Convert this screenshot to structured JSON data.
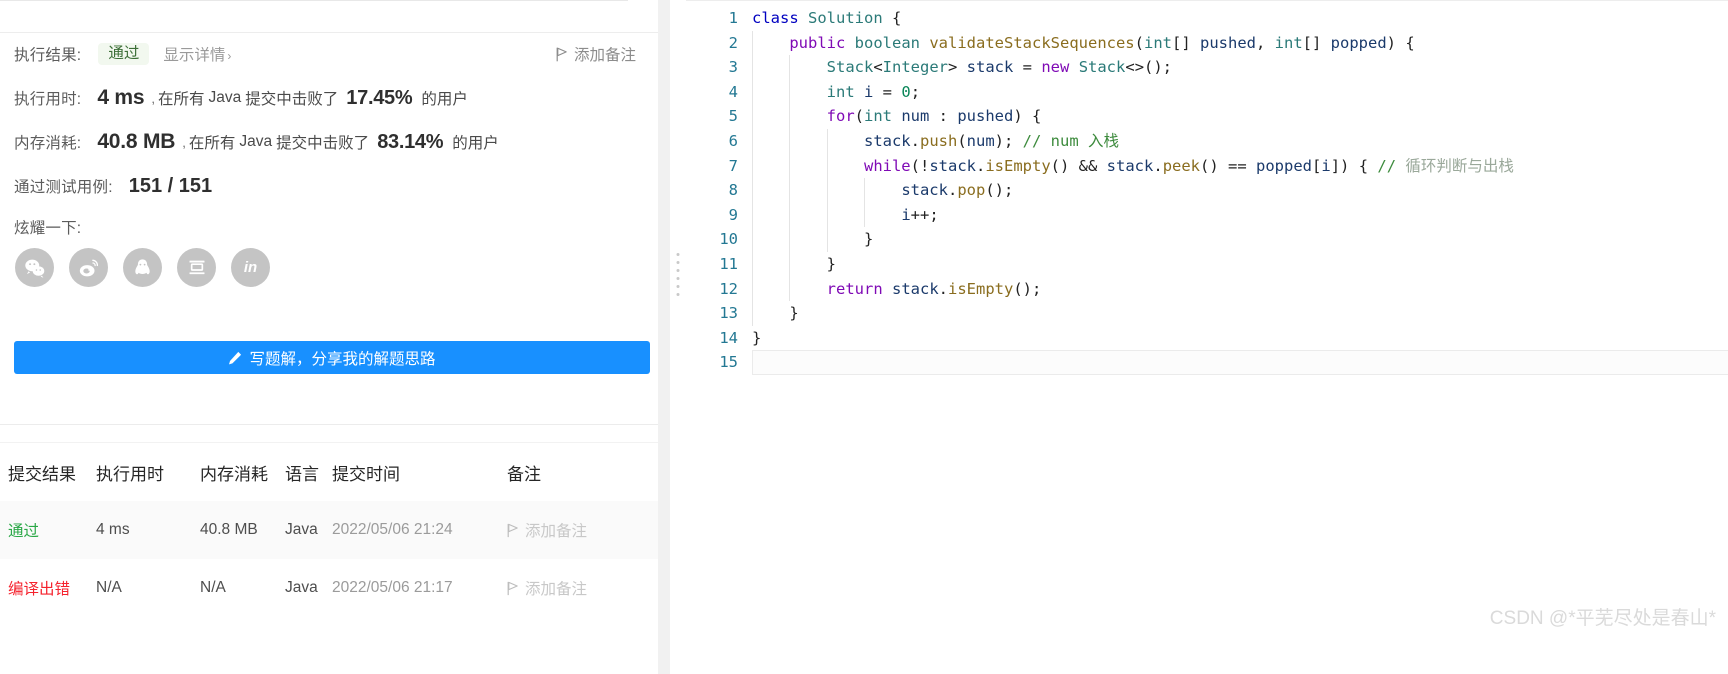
{
  "colors": {
    "accent_blue": "#1890ff",
    "pass_green": "#28a745",
    "error_red": "#f5222d",
    "badge_bg": "#f2f8ef",
    "badge_text": "#3b6e36",
    "line_number": "#237893",
    "watermark": "#dadada"
  },
  "result": {
    "exec_result_label": "执行结果:",
    "status_badge": "通过",
    "show_detail_link": "显示详情",
    "show_detail_chevron": "›",
    "add_note_label": "添加备注",
    "runtime_label": "执行用时:",
    "runtime_value": "4 ms",
    "runtime_comma": ",",
    "runtime_prefix": "在所有",
    "runtime_lang": "Java",
    "runtime_middle": "提交中击败了",
    "runtime_percent": "17.45%",
    "runtime_suffix": "的用户",
    "memory_label": "内存消耗:",
    "memory_value": "40.8 MB",
    "memory_comma": ",",
    "memory_prefix": "在所有",
    "memory_lang": "Java",
    "memory_middle": "提交中击败了",
    "memory_percent": "83.14%",
    "memory_suffix": "的用户",
    "cases_label": "通过测试用例:",
    "cases_value": "151 / 151",
    "flaunt_label": "炫耀一下:",
    "share_icons": [
      {
        "name": "wechat-share-icon",
        "label": "微信"
      },
      {
        "name": "weibo-share-icon",
        "label": "微博"
      },
      {
        "name": "qq-share-icon",
        "label": "QQ"
      },
      {
        "name": "douban-share-icon",
        "label": "豆瓣"
      },
      {
        "name": "linkedin-share-icon",
        "label": "in"
      }
    ],
    "write_solution_button": "写题解，分享我的解题思路"
  },
  "submissions_table": {
    "headers": [
      "提交结果",
      "执行用时",
      "内存消耗",
      "语言",
      "提交时间",
      "备注"
    ],
    "rows": [
      {
        "status": "通过",
        "status_type": "pass",
        "runtime": "4 ms",
        "memory": "40.8 MB",
        "language": "Java",
        "time": "2022/05/06 21:24",
        "note": "添加备注"
      },
      {
        "status": "编译出错",
        "status_type": "error",
        "runtime": "N/A",
        "memory": "N/A",
        "language": "Java",
        "time": "2022/05/06 21:17",
        "note": "添加备注"
      }
    ]
  },
  "editor": {
    "language": "java",
    "active_line": 15,
    "total_lines": 15,
    "lines": [
      {
        "n": "1",
        "tokens": [
          {
            "t": "class ",
            "c": "kw2"
          },
          {
            "t": "Solution",
            "c": "typ"
          },
          {
            "t": " {",
            "c": "pun"
          }
        ]
      },
      {
        "n": "2",
        "tokens": [
          {
            "t": "    ",
            "c": "pun"
          },
          {
            "t": "public",
            "c": "kw"
          },
          {
            "t": " ",
            "c": "pun"
          },
          {
            "t": "boolean",
            "c": "typ"
          },
          {
            "t": " ",
            "c": "pun"
          },
          {
            "t": "validateStackSequences",
            "c": "fn"
          },
          {
            "t": "(",
            "c": "pun"
          },
          {
            "t": "int",
            "c": "typ"
          },
          {
            "t": "[] ",
            "c": "pun"
          },
          {
            "t": "pushed",
            "c": "pln"
          },
          {
            "t": ", ",
            "c": "pun"
          },
          {
            "t": "int",
            "c": "typ"
          },
          {
            "t": "[] ",
            "c": "pun"
          },
          {
            "t": "popped",
            "c": "pln"
          },
          {
            "t": ") {",
            "c": "pun"
          }
        ]
      },
      {
        "n": "3",
        "tokens": [
          {
            "t": "        ",
            "c": "pun"
          },
          {
            "t": "Stack",
            "c": "typ"
          },
          {
            "t": "<",
            "c": "pun"
          },
          {
            "t": "Integer",
            "c": "typ"
          },
          {
            "t": "> ",
            "c": "pun"
          },
          {
            "t": "stack",
            "c": "pln"
          },
          {
            "t": " = ",
            "c": "pun"
          },
          {
            "t": "new",
            "c": "kw"
          },
          {
            "t": " ",
            "c": "pun"
          },
          {
            "t": "Stack",
            "c": "typ"
          },
          {
            "t": "<>();",
            "c": "pun"
          }
        ]
      },
      {
        "n": "4",
        "tokens": [
          {
            "t": "        ",
            "c": "pun"
          },
          {
            "t": "int",
            "c": "typ"
          },
          {
            "t": " ",
            "c": "pun"
          },
          {
            "t": "i",
            "c": "pln"
          },
          {
            "t": " = ",
            "c": "pun"
          },
          {
            "t": "0",
            "c": "num"
          },
          {
            "t": ";",
            "c": "pun"
          }
        ]
      },
      {
        "n": "5",
        "tokens": [
          {
            "t": "        ",
            "c": "pun"
          },
          {
            "t": "for",
            "c": "kw"
          },
          {
            "t": "(",
            "c": "pun"
          },
          {
            "t": "int",
            "c": "typ"
          },
          {
            "t": " ",
            "c": "pun"
          },
          {
            "t": "num",
            "c": "pln"
          },
          {
            "t": " : ",
            "c": "pun"
          },
          {
            "t": "pushed",
            "c": "pln"
          },
          {
            "t": ") {",
            "c": "pun"
          }
        ]
      },
      {
        "n": "6",
        "tokens": [
          {
            "t": "            ",
            "c": "pun"
          },
          {
            "t": "stack",
            "c": "pln"
          },
          {
            "t": ".",
            "c": "pun"
          },
          {
            "t": "push",
            "c": "fn"
          },
          {
            "t": "(",
            "c": "pun"
          },
          {
            "t": "num",
            "c": "pln"
          },
          {
            "t": "); ",
            "c": "pun"
          },
          {
            "t": "// num 入栈",
            "c": "cmt"
          }
        ]
      },
      {
        "n": "7",
        "tokens": [
          {
            "t": "            ",
            "c": "pun"
          },
          {
            "t": "while",
            "c": "kw"
          },
          {
            "t": "(!",
            "c": "pun"
          },
          {
            "t": "stack",
            "c": "pln"
          },
          {
            "t": ".",
            "c": "pun"
          },
          {
            "t": "isEmpty",
            "c": "fn"
          },
          {
            "t": "() && ",
            "c": "pun"
          },
          {
            "t": "stack",
            "c": "pln"
          },
          {
            "t": ".",
            "c": "pun"
          },
          {
            "t": "peek",
            "c": "fn"
          },
          {
            "t": "() == ",
            "c": "pun"
          },
          {
            "t": "popped",
            "c": "pln"
          },
          {
            "t": "[",
            "c": "pun"
          },
          {
            "t": "i",
            "c": "pln"
          },
          {
            "t": "]) { ",
            "c": "pun"
          },
          {
            "t": "// ",
            "c": "cmt"
          },
          {
            "t": "循环判断与出栈",
            "c": "cmtg"
          }
        ]
      },
      {
        "n": "8",
        "tokens": [
          {
            "t": "                ",
            "c": "pun"
          },
          {
            "t": "stack",
            "c": "pln"
          },
          {
            "t": ".",
            "c": "pun"
          },
          {
            "t": "pop",
            "c": "fn"
          },
          {
            "t": "();",
            "c": "pun"
          }
        ]
      },
      {
        "n": "9",
        "tokens": [
          {
            "t": "                ",
            "c": "pun"
          },
          {
            "t": "i",
            "c": "pln"
          },
          {
            "t": "++;",
            "c": "pun"
          }
        ]
      },
      {
        "n": "10",
        "tokens": [
          {
            "t": "            }",
            "c": "pun"
          }
        ]
      },
      {
        "n": "11",
        "tokens": [
          {
            "t": "        }",
            "c": "pun"
          }
        ]
      },
      {
        "n": "12",
        "tokens": [
          {
            "t": "        ",
            "c": "pun"
          },
          {
            "t": "return",
            "c": "kw"
          },
          {
            "t": " ",
            "c": "pun"
          },
          {
            "t": "stack",
            "c": "pln"
          },
          {
            "t": ".",
            "c": "pun"
          },
          {
            "t": "isEmpty",
            "c": "fn"
          },
          {
            "t": "();",
            "c": "pun"
          }
        ]
      },
      {
        "n": "13",
        "tokens": [
          {
            "t": "    }",
            "c": "pun"
          }
        ]
      },
      {
        "n": "14",
        "tokens": [
          {
            "t": "}",
            "c": "pun"
          }
        ]
      },
      {
        "n": "15",
        "tokens": []
      }
    ]
  },
  "watermark": "CSDN @*平芜尽处是春山*"
}
